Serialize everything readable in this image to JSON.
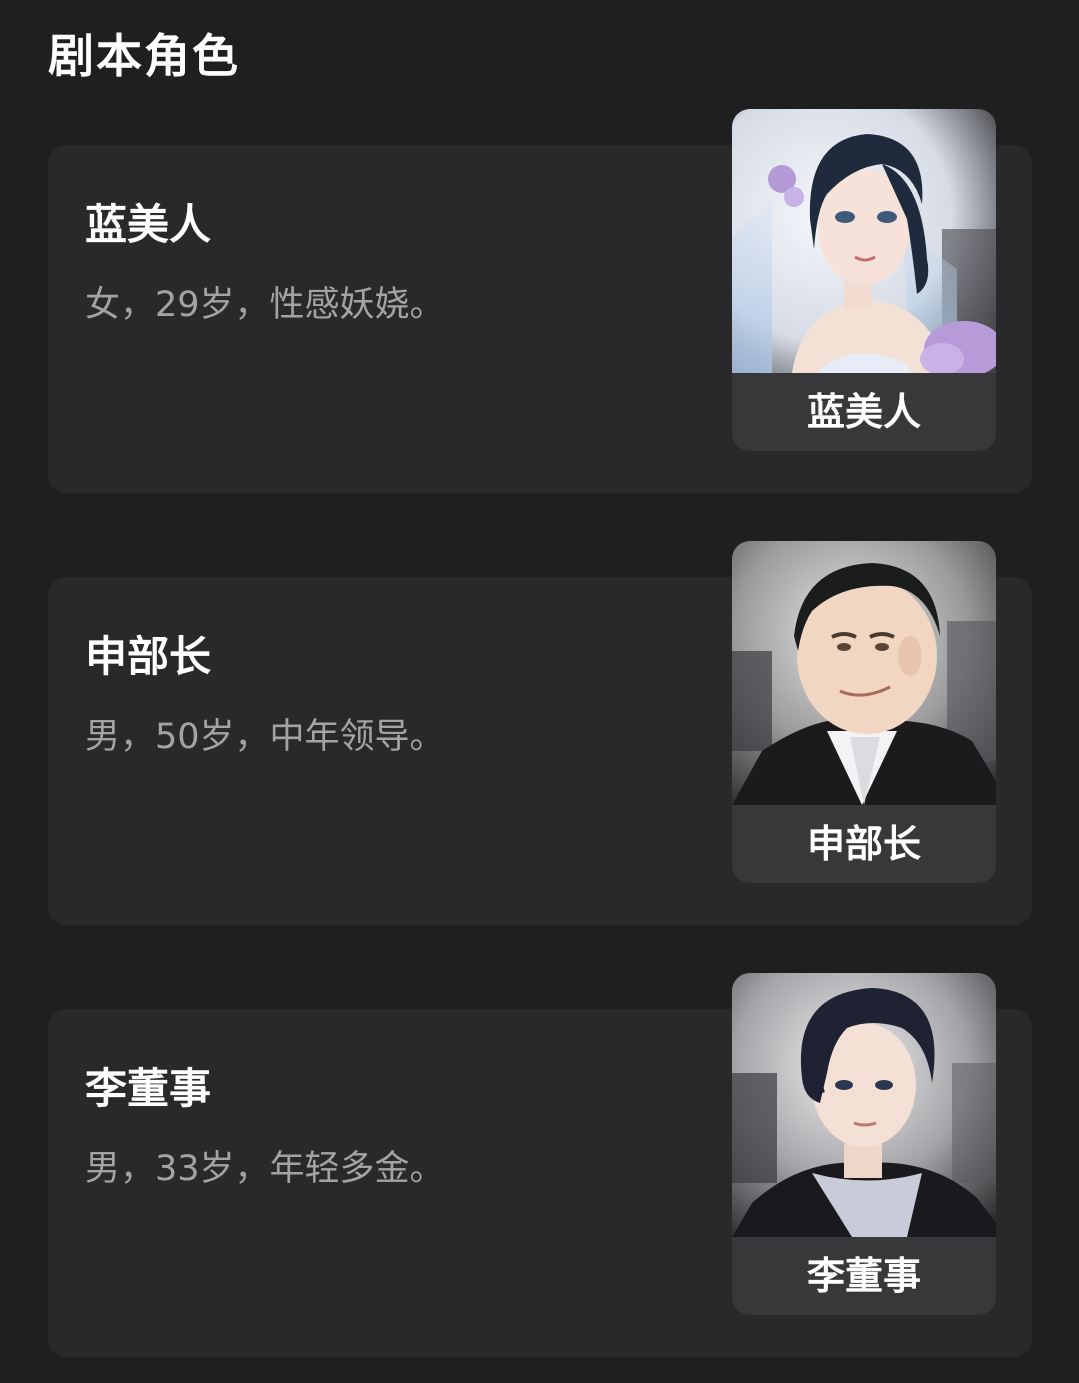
{
  "section": {
    "title": "剧本角色"
  },
  "roles": [
    {
      "name": "蓝美人",
      "desc": "女，29岁，性感妖娆。",
      "caption": "蓝美人",
      "portrait_icon": "bride-portrait"
    },
    {
      "name": "申部长",
      "desc": "男，50岁，中年领导。",
      "caption": "申部长",
      "portrait_icon": "older-man-portrait"
    },
    {
      "name": "李董事",
      "desc": "男，33岁，年轻多金。",
      "caption": "李董事",
      "portrait_icon": "young-man-portrait"
    }
  ],
  "colors": {
    "background": "#1f1f21",
    "card": "#29292c",
    "caption_bg": "#38383b",
    "desc_text": "#a3a3a6"
  }
}
